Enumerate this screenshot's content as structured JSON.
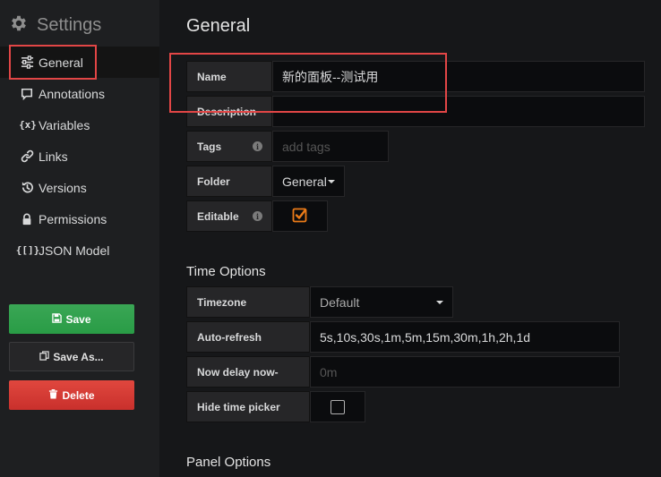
{
  "sidebar": {
    "title": "Settings",
    "items": [
      {
        "label": "General",
        "icon": "sliders-icon"
      },
      {
        "label": "Annotations",
        "icon": "comment-icon"
      },
      {
        "label": "Variables",
        "icon": "variables-icon",
        "glyph": "{x}"
      },
      {
        "label": "Links",
        "icon": "link-icon"
      },
      {
        "label": "Versions",
        "icon": "history-icon"
      },
      {
        "label": "Permissions",
        "icon": "lock-icon"
      },
      {
        "label": "JSON Model",
        "icon": "json-icon",
        "glyph": "{[]}"
      }
    ],
    "save_label": "Save",
    "save_as_label": "Save As...",
    "delete_label": "Delete"
  },
  "general": {
    "title": "General",
    "name_label": "Name",
    "name_value": "新的面板--测试用",
    "description_label": "Description",
    "description_value": "",
    "tags_label": "Tags",
    "tags_placeholder": "add tags",
    "folder_label": "Folder",
    "folder_value": "General",
    "editable_label": "Editable",
    "editable_checked": true
  },
  "time_options": {
    "title": "Time Options",
    "timezone_label": "Timezone",
    "timezone_value": "Default",
    "auto_refresh_label": "Auto-refresh",
    "auto_refresh_value": "5s,10s,30s,1m,5m,15m,30m,1h,2h,1d",
    "now_delay_label": "Now delay now-",
    "now_delay_placeholder": "0m",
    "hide_time_picker_label": "Hide time picker",
    "hide_time_picker_checked": false
  },
  "panel_options": {
    "title": "Panel Options"
  },
  "colors": {
    "accent_orange": "#eb7b18",
    "save_green": "#299c46",
    "delete_red": "#d44a3a",
    "highlight_red": "#e24646"
  }
}
